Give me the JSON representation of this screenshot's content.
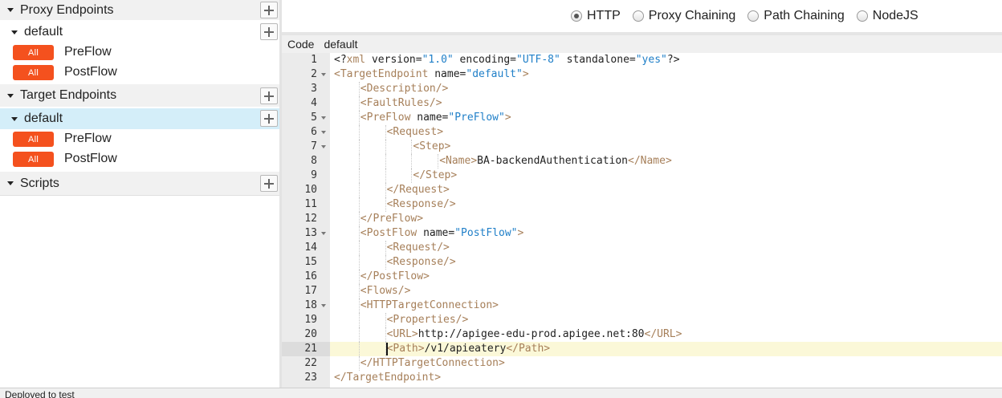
{
  "navigator": {
    "proxy_endpoints_label": "Proxy Endpoints",
    "proxy_default_label": "default",
    "proxy_preflow_badge": "All",
    "proxy_preflow_label": "PreFlow",
    "proxy_postflow_badge": "All",
    "proxy_postflow_label": "PostFlow",
    "target_endpoints_label": "Target Endpoints",
    "target_default_label": "default",
    "target_preflow_badge": "All",
    "target_preflow_label": "PreFlow",
    "target_postflow_badge": "All",
    "target_postflow_label": "PostFlow",
    "scripts_label": "Scripts"
  },
  "radio_bar": {
    "options": [
      "HTTP",
      "Proxy Chaining",
      "Path Chaining",
      "NodeJS"
    ],
    "selected": "HTTP"
  },
  "code_header": {
    "code_tab": "Code",
    "file_label": "default"
  },
  "editor": {
    "active_line": 21,
    "lines": [
      {
        "n": "1",
        "parts": [
          [
            "pi",
            "<?"
          ],
          [
            "tag",
            "xml"
          ],
          [
            "attr",
            " version="
          ],
          [
            "val",
            "\"1.0\""
          ],
          [
            "attr",
            " encoding="
          ],
          [
            "val",
            "\"UTF-8\""
          ],
          [
            "attr",
            " standalone="
          ],
          [
            "val",
            "\"yes\""
          ],
          [
            "pi",
            "?>"
          ]
        ]
      },
      {
        "n": "2",
        "parts": [
          [
            "tag",
            "<TargetEndpoint"
          ],
          [
            "attr",
            " name="
          ],
          [
            "val",
            "\"default\""
          ],
          [
            "tag",
            ">"
          ]
        ]
      },
      {
        "n": "3",
        "parts": [
          [
            "tag",
            "<Description/>"
          ]
        ]
      },
      {
        "n": "4",
        "parts": [
          [
            "tag",
            "<FaultRules/>"
          ]
        ]
      },
      {
        "n": "5",
        "parts": [
          [
            "tag",
            "<PreFlow"
          ],
          [
            "attr",
            " name="
          ],
          [
            "val",
            "\"PreFlow\""
          ],
          [
            "tag",
            ">"
          ]
        ]
      },
      {
        "n": "6",
        "parts": [
          [
            "tag",
            "<Request>"
          ]
        ]
      },
      {
        "n": "7",
        "parts": [
          [
            "tag",
            "<Step>"
          ]
        ]
      },
      {
        "n": "8",
        "parts": [
          [
            "tag",
            "<Name>"
          ],
          [
            "txt",
            "BA-backendAuthentication"
          ],
          [
            "tag",
            "</Name>"
          ]
        ]
      },
      {
        "n": "9",
        "parts": [
          [
            "tag",
            "</Step>"
          ]
        ]
      },
      {
        "n": "10",
        "parts": [
          [
            "tag",
            "</Request>"
          ]
        ]
      },
      {
        "n": "11",
        "parts": [
          [
            "tag",
            "<Response/>"
          ]
        ]
      },
      {
        "n": "12",
        "parts": [
          [
            "tag",
            "</PreFlow>"
          ]
        ]
      },
      {
        "n": "13",
        "parts": [
          [
            "tag",
            "<PostFlow"
          ],
          [
            "attr",
            " name="
          ],
          [
            "val",
            "\"PostFlow\""
          ],
          [
            "tag",
            ">"
          ]
        ]
      },
      {
        "n": "14",
        "parts": [
          [
            "tag",
            "<Request/>"
          ]
        ]
      },
      {
        "n": "15",
        "parts": [
          [
            "tag",
            "<Response/>"
          ]
        ]
      },
      {
        "n": "16",
        "parts": [
          [
            "tag",
            "</PostFlow>"
          ]
        ]
      },
      {
        "n": "17",
        "parts": [
          [
            "tag",
            "<Flows/>"
          ]
        ]
      },
      {
        "n": "18",
        "parts": [
          [
            "tag",
            "<HTTPTargetConnection>"
          ]
        ]
      },
      {
        "n": "19",
        "parts": [
          [
            "tag",
            "<Properties/>"
          ]
        ]
      },
      {
        "n": "20",
        "parts": [
          [
            "tag",
            "<URL>"
          ],
          [
            "txt",
            "http://apigee-edu-prod.apigee.net:80"
          ],
          [
            "tag",
            "</URL>"
          ]
        ]
      },
      {
        "n": "21",
        "parts": [
          [
            "tag",
            "<Path>"
          ],
          [
            "txt",
            "/v1/apieatery"
          ],
          [
            "tag",
            "</Path>"
          ]
        ]
      },
      {
        "n": "22",
        "parts": [
          [
            "tag",
            "</HTTPTargetConnection>"
          ]
        ]
      },
      {
        "n": "23",
        "parts": [
          [
            "tag",
            "</TargetEndpoint>"
          ]
        ]
      }
    ]
  },
  "status": {
    "text": "Deployed to test"
  }
}
